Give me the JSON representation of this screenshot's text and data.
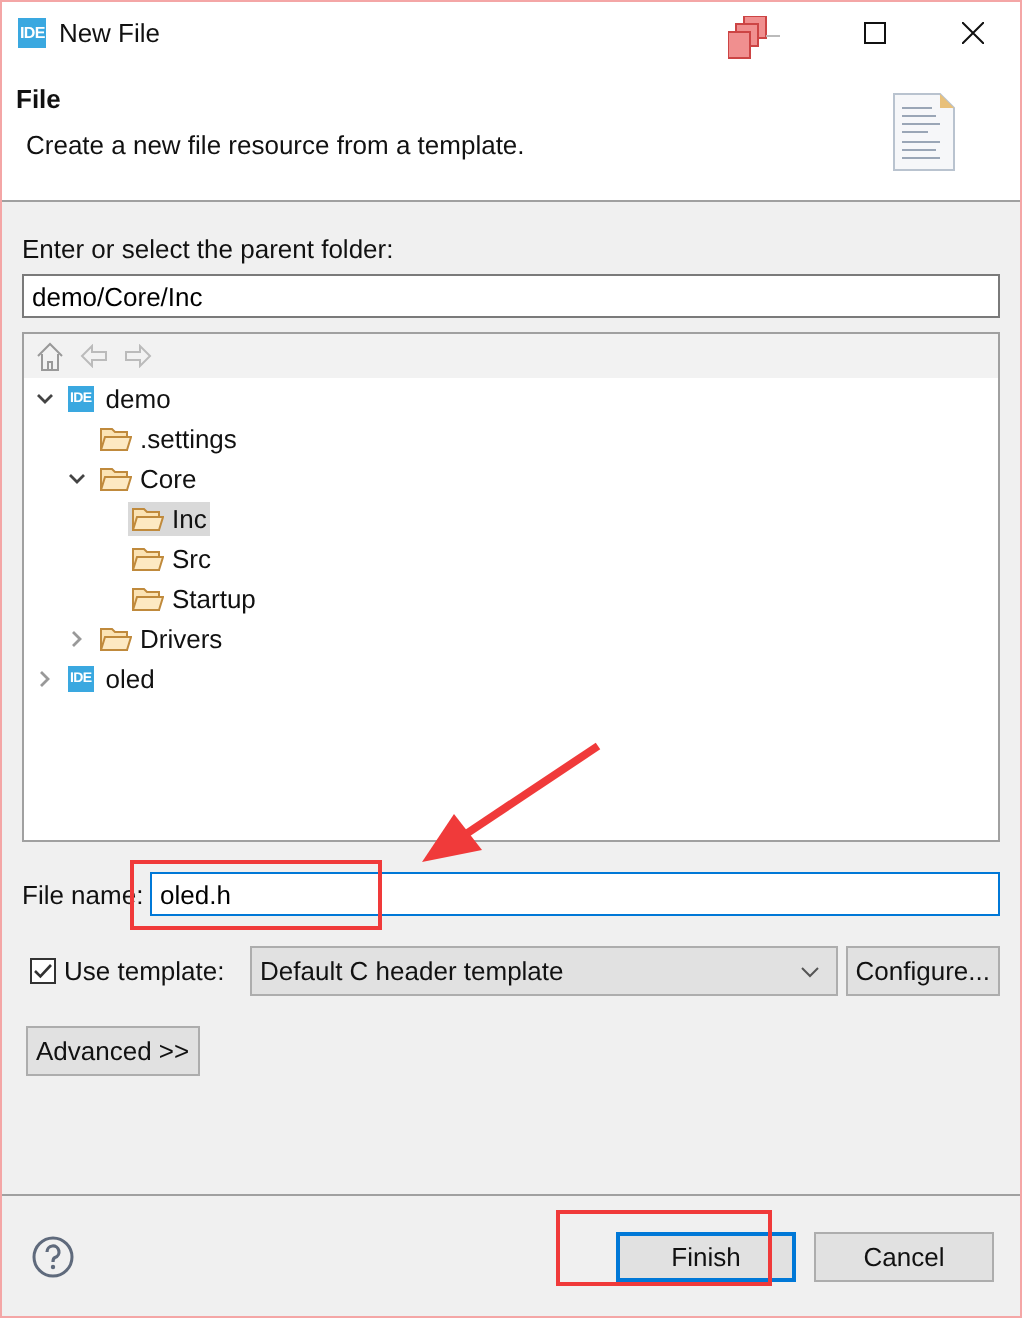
{
  "window": {
    "title": "New File",
    "app_badge": "IDE"
  },
  "header": {
    "title": "File",
    "description": "Create a new file resource from a template."
  },
  "parent_folder": {
    "label": "Enter or select the parent folder:",
    "value": "demo/Core/Inc"
  },
  "tree": [
    {
      "label": "demo",
      "kind": "project",
      "badge": "IDE",
      "expanded": true,
      "selected": false,
      "children": [
        {
          "label": ".settings",
          "kind": "folder",
          "selected": false
        },
        {
          "label": "Core",
          "kind": "folder",
          "expanded": true,
          "selected": false,
          "children": [
            {
              "label": "Inc",
              "kind": "folder",
              "selected": true
            },
            {
              "label": "Src",
              "kind": "folder",
              "selected": false
            },
            {
              "label": "Startup",
              "kind": "folder",
              "selected": false
            }
          ]
        },
        {
          "label": "Drivers",
          "kind": "folder",
          "expanded": false,
          "selected": false
        }
      ]
    },
    {
      "label": "oled",
      "kind": "project",
      "badge": "IDE",
      "expanded": false,
      "selected": false
    }
  ],
  "file_name": {
    "label": "File name:",
    "value": "oled.h"
  },
  "template": {
    "label": "Use template:",
    "checked": true,
    "value": "Default C header template",
    "configure": "Configure..."
  },
  "advanced": "Advanced >>",
  "buttons": {
    "finish": "Finish",
    "cancel": "Cancel"
  }
}
